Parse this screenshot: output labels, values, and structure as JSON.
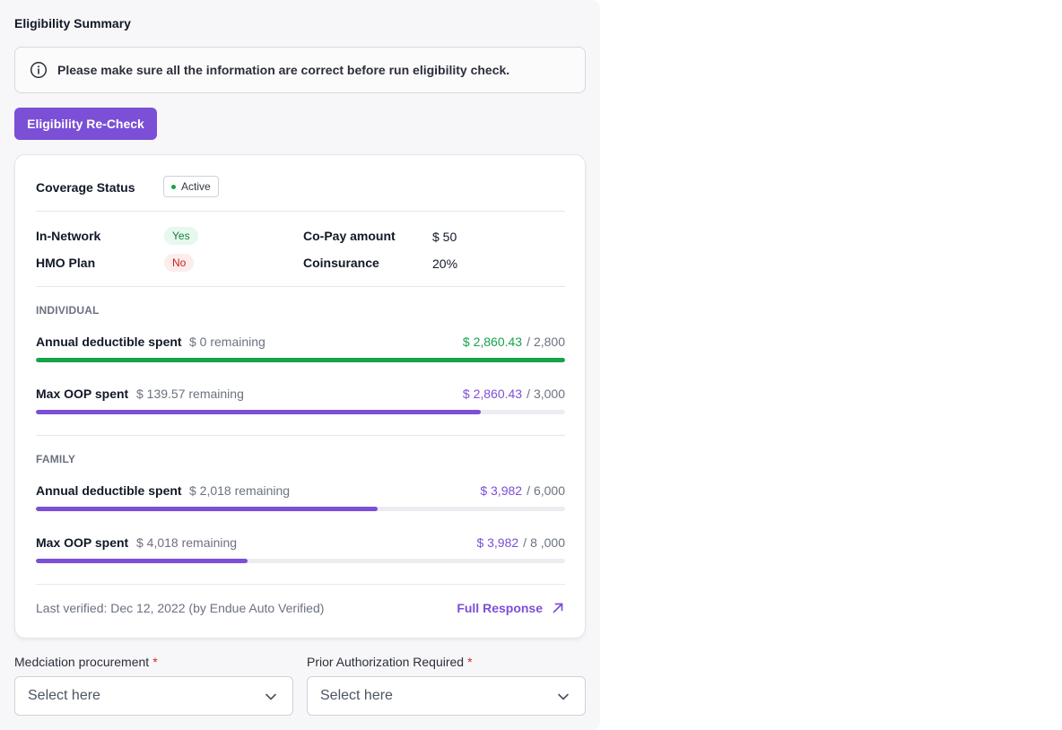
{
  "section_title": "Eligibility Summary",
  "info": {
    "text": "Please make sure all the information are correct before run eligibility check."
  },
  "recheck_button": "Eligibility Re-Check",
  "coverage": {
    "label": "Coverage Status",
    "status": "Active"
  },
  "details": {
    "in_network_label": "In-Network",
    "in_network_value": "Yes",
    "hmo_label": "HMO Plan",
    "hmo_value": "No",
    "copay_label": "Co-Pay amount",
    "copay_value": "$ 50",
    "coinsurance_label": "Coinsurance",
    "coinsurance_value": "20%"
  },
  "individual": {
    "title": "INDIVIDUAL",
    "deductible": {
      "label": "Annual deductible spent",
      "remaining": "$ 0 remaining",
      "spent": "$ 2,860.43",
      "total": "2,800",
      "progress": 1.0
    },
    "oop": {
      "label": "Max OOP spent",
      "remaining": "$ 139.57 remaining",
      "spent": "$ 2,860.43",
      "total": "3,000",
      "progress": 0.84
    }
  },
  "family": {
    "title": "FAMILY",
    "deductible": {
      "label": "Annual deductible spent",
      "remaining": "$ 2,018 remaining",
      "spent": "$ 3,982",
      "total": "6,000",
      "progress": 0.645
    },
    "oop": {
      "label": "Max OOP spent",
      "remaining": "$ 4,018 remaining",
      "spent": "$ 3,982",
      "total": "8 ,000",
      "progress": 0.4
    }
  },
  "footer": {
    "verified": "Last verified: Dec 12, 2022  (by Endue Auto Verified)",
    "full_response": "Full Response"
  },
  "fields": {
    "procurement_label": "Medciation procurement",
    "authorization_label": "Prior Authorization Required",
    "required_mark": "*",
    "placeholder": "Select here"
  },
  "icons": {
    "info": "info-icon",
    "arrow": "arrow-up-right-icon",
    "chevron": "chevron-down-icon"
  },
  "colors": {
    "accent": "#7b4fd6",
    "success": "#16a34a",
    "danger": "#dc2626"
  }
}
